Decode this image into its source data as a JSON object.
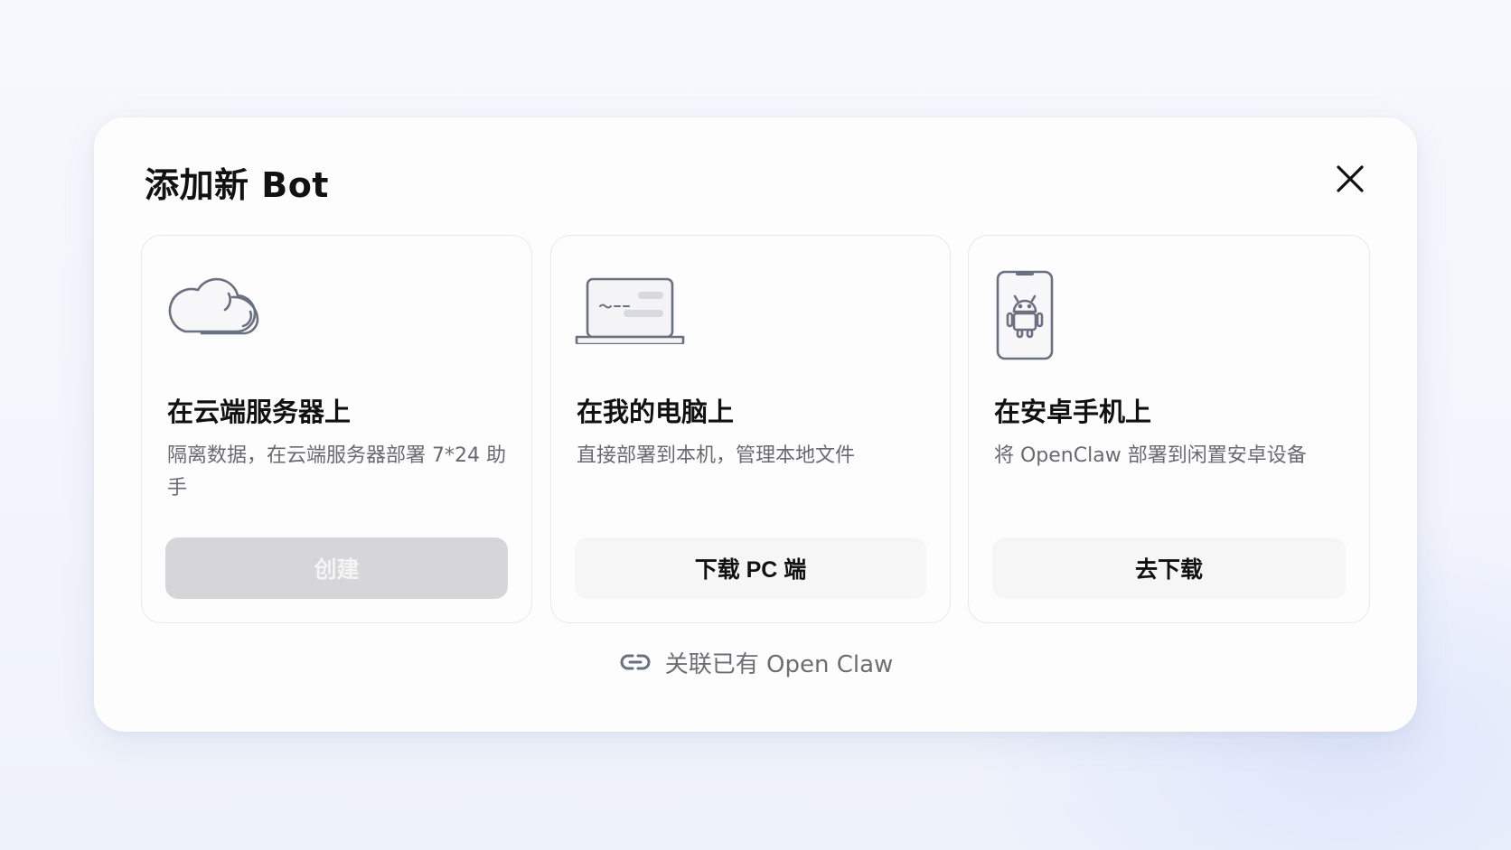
{
  "modal": {
    "title": "添加新 Bot",
    "close_icon": "close-icon"
  },
  "cards": [
    {
      "icon": "cloud-icon",
      "title": "在云端服务器上",
      "description": "隔离数据，在云端服务器部署 7*24 助手",
      "button_label": "创建",
      "button_state": "disabled"
    },
    {
      "icon": "laptop-icon",
      "title": "在我的电脑上",
      "description": "直接部署到本机，管理本地文件",
      "button_label": "下载 PC 端",
      "button_state": "enabled"
    },
    {
      "icon": "android-phone-icon",
      "title": "在安卓手机上",
      "description": "将 OpenClaw 部署到闲置安卓设备",
      "button_label": "去下载",
      "button_state": "enabled"
    }
  ],
  "footer_link": {
    "icon": "link-icon",
    "label": "关联已有 Open Claw"
  },
  "colors": {
    "icon_stroke": "#6b7080",
    "disabled_button": "#d6d6d8",
    "button_bg": "#f6f6f7"
  }
}
